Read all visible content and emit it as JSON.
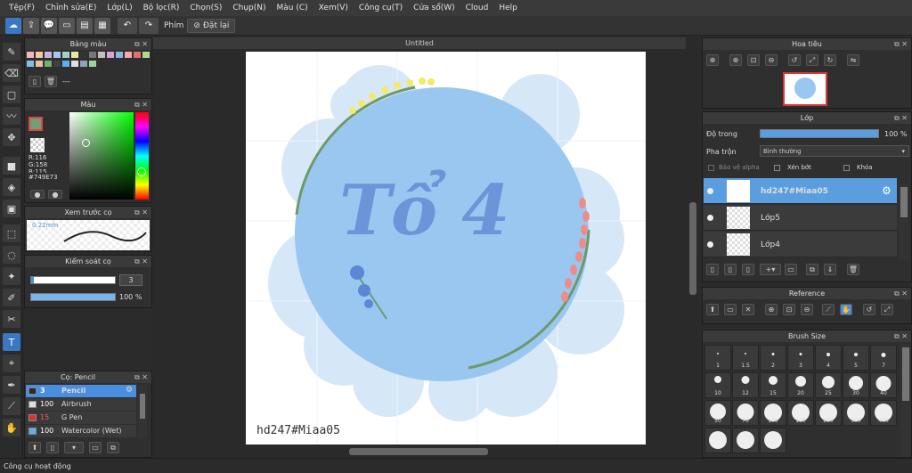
{
  "menubar": {
    "items": [
      "Tệp(F)",
      "Chỉnh sửa(E)",
      "Lớp(L)",
      "Bộ lọc(R)",
      "Chọn(S)",
      "Chụp(N)",
      "Màu (C)",
      "Xem(V)",
      "Công cụ(T)",
      "Cửa sổ(W)",
      "Cloud",
      "Help"
    ]
  },
  "toolbar": {
    "phim_label": "Phím",
    "reset_label": "Đặt lại"
  },
  "palette": {
    "title": "Bảng màu",
    "info": "---"
  },
  "color": {
    "title": "Màu",
    "r": "R:116",
    "g": "G:158",
    "b": "B:115",
    "hex": "#749E73",
    "swatch": "#749e73"
  },
  "preview": {
    "title": "Xem trước cọ",
    "size": "0.22mm"
  },
  "brush_control": {
    "title": "Kiểm soát cọ",
    "size": "3",
    "opacity": "100 %"
  },
  "brushes": {
    "title": "Cọ: Pencil",
    "items": [
      {
        "size": "3",
        "name": "Pencil",
        "color": "#2a2a2a",
        "selected": true
      },
      {
        "size": "100",
        "name": "Airbrush",
        "color": "#e0e0e0",
        "selected": false
      },
      {
        "size": "15",
        "name": "G Pen",
        "color": "#e03030",
        "selected": false
      },
      {
        "size": "100",
        "name": "Watercolor (Wet)",
        "color": "#5ab0f0",
        "selected": false
      }
    ]
  },
  "canvas": {
    "tab": "Untitled",
    "signature": "hd247#Miaa05",
    "artwork_text": "Tổ 4"
  },
  "navigator": {
    "title": "Hoa tiêu"
  },
  "layers": {
    "title": "Lớp",
    "opacity_label": "Độ trong",
    "opacity_value": "100 %",
    "blend_label": "Pha trộn",
    "blend_value": "Bình thường",
    "protect_alpha": "Bảo vệ alpha",
    "clip": "Xén bớt",
    "lock": "Khóa",
    "items": [
      {
        "name": "hd247#Miaa05",
        "selected": true
      },
      {
        "name": "Lớp5",
        "selected": false
      },
      {
        "name": "Lớp4",
        "selected": false
      }
    ]
  },
  "reference": {
    "title": "Reference"
  },
  "brush_size": {
    "title": "Brush Size",
    "row1": [
      "1",
      "1.5",
      "2",
      "3",
      "4",
      "5",
      "7"
    ],
    "row2": [
      "10",
      "12",
      "15",
      "20",
      "25",
      "30",
      "40"
    ],
    "row3": [
      "50",
      "70",
      "100",
      "150",
      "200",
      "300",
      "400"
    ]
  },
  "status": {
    "text": "Công cụ hoạt động"
  }
}
